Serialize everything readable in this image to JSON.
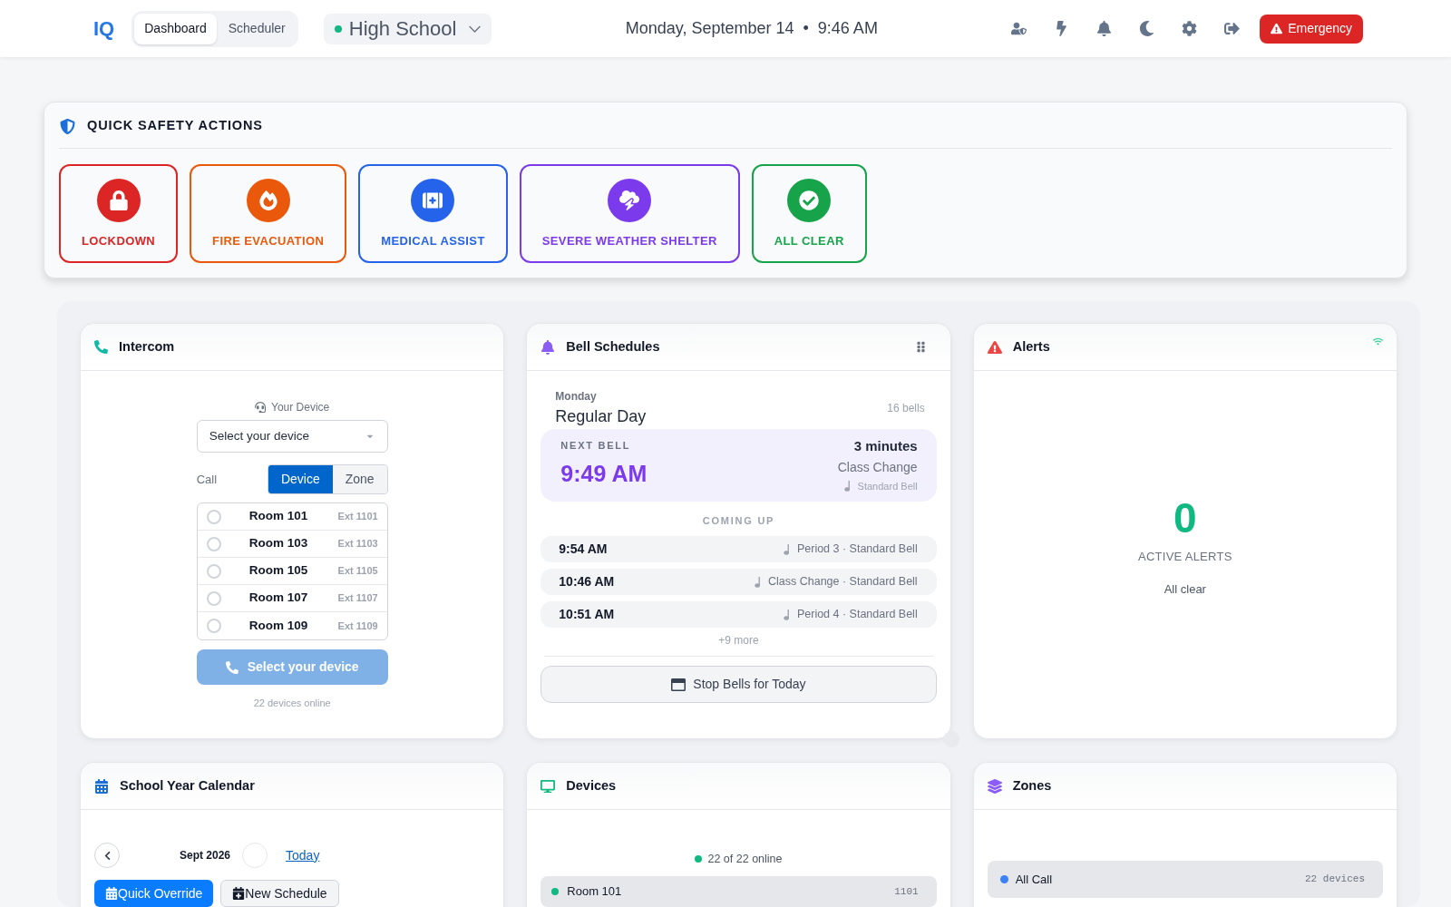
{
  "header": {
    "logo": "IQ",
    "view_tabs": [
      {
        "label": "Dashboard",
        "selected": true
      },
      {
        "label": "Scheduler",
        "selected": false
      }
    ],
    "school_selector": {
      "value": "High School",
      "online": true
    },
    "date": "Monday, September 14",
    "separator": "•",
    "time": "9:46 AM",
    "emergency_button": "Emergency"
  },
  "quick_actions": {
    "title": "QUICK SAFETY ACTIONS",
    "actions": [
      {
        "kind": "lockdown",
        "label": "LOCKDOWN",
        "color": "#dc2626"
      },
      {
        "kind": "fire",
        "label": "FIRE EVACUATION",
        "color": "#ea580c"
      },
      {
        "kind": "medical",
        "label": "MEDICAL ASSIST",
        "color": "#2563eb"
      },
      {
        "kind": "weather",
        "label": "SEVERE WEATHER SHELTER",
        "color": "#7c3aed"
      },
      {
        "kind": "all_clear",
        "label": "ALL CLEAR",
        "color": "#16a34a"
      }
    ]
  },
  "intercom": {
    "title": "Intercom",
    "device_label": "Your Device",
    "device_select": {
      "placeholder": "Select your device"
    },
    "call_label": "Call",
    "call_modes": [
      {
        "label": "Device",
        "selected": true
      },
      {
        "label": "Zone",
        "selected": false
      }
    ],
    "devices": [
      {
        "name": "Room 101",
        "ext": "Ext 1101",
        "selected": false
      },
      {
        "name": "Room 103",
        "ext": "Ext 1103",
        "selected": false
      },
      {
        "name": "Room 105",
        "ext": "Ext 1105",
        "selected": false
      },
      {
        "name": "Room 107",
        "ext": "Ext 1107",
        "selected": false
      },
      {
        "name": "Room 109",
        "ext": "Ext 1109",
        "selected": false
      }
    ],
    "call_button": {
      "label": "Select your device",
      "disabled": true
    },
    "status": "22 devices online"
  },
  "bell_schedules": {
    "title": "Bell Schedules",
    "day": "Monday",
    "schedule": "Regular Day",
    "bell_count": "16 bells",
    "next_bell": {
      "label": "NEXT BELL",
      "time": "9:49 AM",
      "countdown": "3 minutes",
      "name": "Class Change",
      "sound": "Standard Bell"
    },
    "coming_up_label": "COMING UP",
    "upcoming": [
      {
        "time": "9:54 AM",
        "detail": "Period 3 · Standard Bell"
      },
      {
        "time": "10:46 AM",
        "detail": "Class Change · Standard Bell"
      },
      {
        "time": "10:51 AM",
        "detail": "Period 4 · Standard Bell"
      }
    ],
    "more": "+9 more",
    "stop_button": "Stop Bells for Today"
  },
  "alerts": {
    "title": "Alerts",
    "count": "0",
    "count_label": "ACTIVE ALERTS",
    "message": "All clear"
  },
  "calendar": {
    "title": "School Year Calendar",
    "month": "Sept 2026",
    "today_link": "Today",
    "buttons": [
      {
        "kind": "primary",
        "label": "Quick Override"
      },
      {
        "kind": "secondary",
        "label": "New Schedule"
      }
    ]
  },
  "devices": {
    "title": "Devices",
    "summary": "22 of 22 online",
    "items": [
      {
        "name": "Room 101",
        "ext": "1101",
        "online": true
      }
    ]
  },
  "zones": {
    "title": "Zones",
    "items": [
      {
        "name": "All Call",
        "count": "22 devices",
        "color": "#3b82f6"
      }
    ]
  }
}
